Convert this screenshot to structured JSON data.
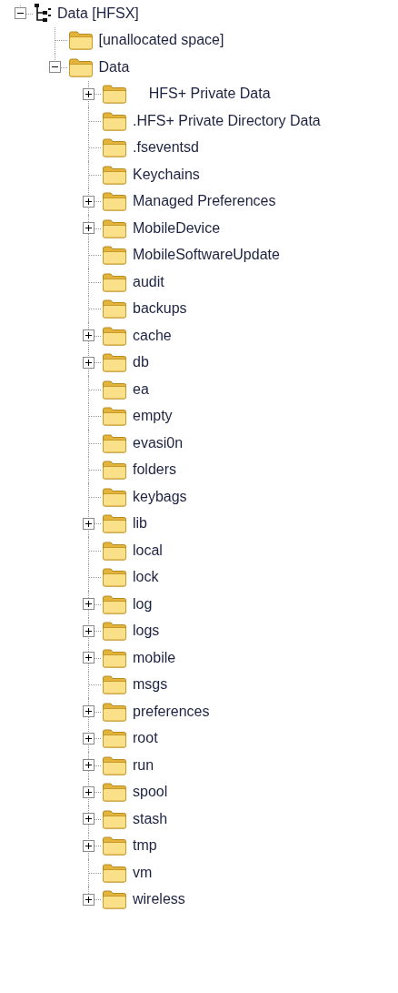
{
  "tree": [
    {
      "kind": "volume",
      "label": "Data [HFSX]",
      "expanded": true,
      "children": [
        {
          "kind": "folder",
          "label": "[unallocated space]"
        },
        {
          "kind": "folder",
          "label": "Data",
          "expanded": true,
          "children": [
            {
              "kind": "folder",
              "label": "    HFS+ Private Data",
              "expanded": false
            },
            {
              "kind": "folder",
              "label": ".HFS+ Private Directory Data"
            },
            {
              "kind": "folder",
              "label": ".fseventsd"
            },
            {
              "kind": "folder",
              "label": "Keychains"
            },
            {
              "kind": "folder",
              "label": "Managed Preferences",
              "expanded": false
            },
            {
              "kind": "folder",
              "label": "MobileDevice",
              "expanded": false
            },
            {
              "kind": "folder",
              "label": "MobileSoftwareUpdate"
            },
            {
              "kind": "folder",
              "label": "audit"
            },
            {
              "kind": "folder",
              "label": "backups"
            },
            {
              "kind": "folder",
              "label": "cache",
              "expanded": false
            },
            {
              "kind": "folder",
              "label": "db",
              "expanded": false
            },
            {
              "kind": "folder",
              "label": "ea"
            },
            {
              "kind": "folder",
              "label": "empty"
            },
            {
              "kind": "folder",
              "label": "evasi0n"
            },
            {
              "kind": "folder",
              "label": "folders"
            },
            {
              "kind": "folder",
              "label": "keybags"
            },
            {
              "kind": "folder",
              "label": "lib",
              "expanded": false
            },
            {
              "kind": "folder",
              "label": "local"
            },
            {
              "kind": "folder",
              "label": "lock"
            },
            {
              "kind": "folder",
              "label": "log",
              "expanded": false
            },
            {
              "kind": "folder",
              "label": "logs",
              "expanded": false
            },
            {
              "kind": "folder",
              "label": "mobile",
              "expanded": false
            },
            {
              "kind": "folder",
              "label": "msgs"
            },
            {
              "kind": "folder",
              "label": "preferences",
              "expanded": false
            },
            {
              "kind": "folder",
              "label": "root",
              "expanded": false
            },
            {
              "kind": "folder",
              "label": "run",
              "expanded": false
            },
            {
              "kind": "folder",
              "label": "spool",
              "expanded": false
            },
            {
              "kind": "folder",
              "label": "stash",
              "expanded": false
            },
            {
              "kind": "folder",
              "label": "tmp",
              "expanded": false
            },
            {
              "kind": "folder",
              "label": "vm"
            },
            {
              "kind": "folder",
              "label": "wireless",
              "expanded": false
            }
          ]
        }
      ]
    }
  ]
}
